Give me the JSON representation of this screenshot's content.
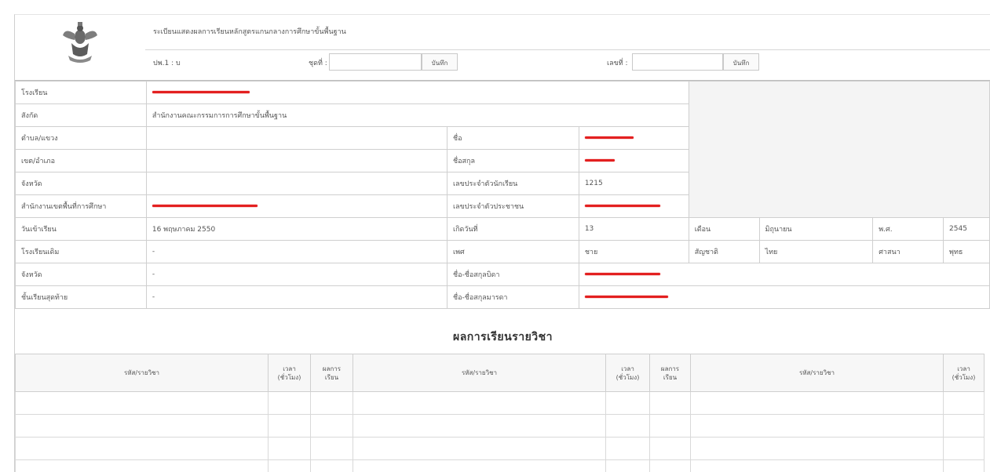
{
  "header": {
    "title": "ระเบียนแสดงผลการเรียนหลักสูตรแกนกลางการศึกษาขั้นพื้นฐาน",
    "form_code": "ปพ.1 : บ",
    "series_label": "ชุดที่ :",
    "series_value": "",
    "number_label": "เลขที่ :",
    "number_value": "",
    "save_label": "บันทึก",
    "save2_label": "บันทึก"
  },
  "info": {
    "school_label": "โรงเรียน",
    "affiliation_label": "สังกัด",
    "affiliation_value": "สำนักงานคณะกรรมการการศึกษาขั้นพื้นฐาน",
    "subdistrict_label": "ตำบล/แขวง",
    "district_label": "เขต/อำเภอ",
    "province_label": "จังหวัด",
    "area_office_label": "สำนักงานเขตพื้นที่การศึกษา",
    "enroll_date_label": "วันเข้าเรียน",
    "enroll_date_value": "16 พฤษภาคม 2550",
    "prev_school_label": "โรงเรียนเดิม",
    "prev_school_value": "-",
    "prev_province_label": "จังหวัด",
    "prev_province_value": "-",
    "last_grade_label": "ชั้นเรียนสุดท้าย",
    "last_grade_value": "-",
    "first_name_label": "ชื่อ",
    "last_name_label": "ชื่อสกุล",
    "student_id_label": "เลขประจำตัวนักเรียน",
    "student_id_value": "1215",
    "national_id_label": "เลขประจำตัวประชาชน",
    "birth_day_label": "เกิดวันที่",
    "birth_day_value": "13",
    "month_label": "เดือน",
    "month_value": "มิถุนายน",
    "year_label": "พ.ศ.",
    "year_value": "2545",
    "sex_label": "เพศ",
    "sex_value": "ชาย",
    "nationality_label": "สัญชาติ",
    "nationality_value": "ไทย",
    "religion_label": "ศาสนา",
    "religion_value": "พุทธ",
    "father_label": "ชื่อ-ชื่อสกุลบิดา",
    "mother_label": "ชื่อ-ชื่อสกุลมารดา",
    "redaction_color": "#e32020"
  },
  "results": {
    "title": "ผลการเรียนรายวิชา",
    "col_subject": "รหัส/รายวิชา",
    "col_time_1": "เวลา",
    "col_time_2": "(ชั่วโมง)",
    "col_grade_1": "ผลการ",
    "col_grade_2": "เรียน"
  }
}
